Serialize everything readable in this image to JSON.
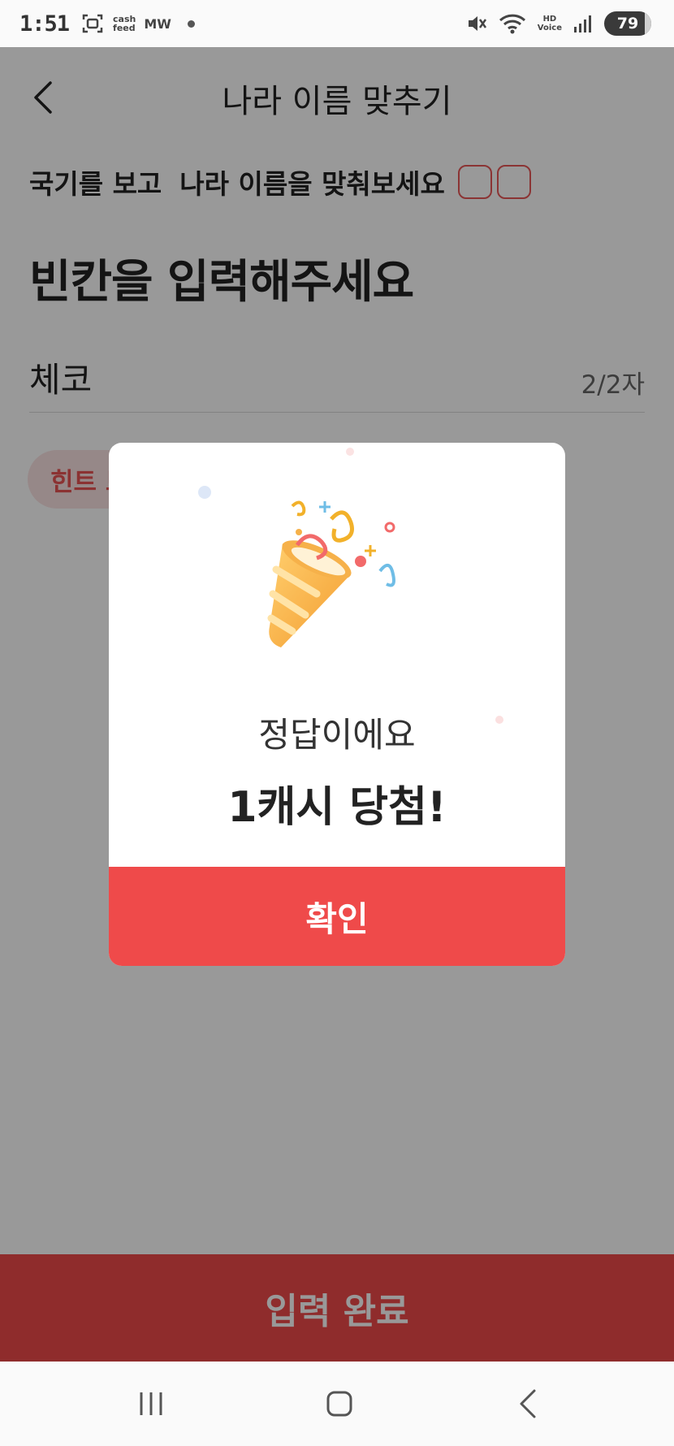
{
  "status_bar": {
    "time": "1:51",
    "app_label_top": "cash",
    "app_label_bottom": "feed",
    "carrier": "MW",
    "hd_top": "HD",
    "hd_bottom": "Voice",
    "battery": "79"
  },
  "header": {
    "title": "나라 이름 맞추기"
  },
  "quiz": {
    "instruction_part1": "국기를 보고",
    "instruction_part2": "나라 이름을 맞춰보세요",
    "blank_count": 2,
    "heading": "빈칸을 입력해주세요",
    "answer_value": "체코",
    "char_count": "2/2자",
    "hint_label": "힌트 보기"
  },
  "bottom_button": {
    "label": "입력 완료"
  },
  "modal": {
    "message": "정답이에요",
    "reward": "1캐시 당첨!",
    "confirm_label": "확인"
  },
  "colors": {
    "accent": "#ef4a4a",
    "hint_bg": "#fbe3e3",
    "overlay": "rgba(0,0,0,0.40)"
  },
  "icons": {
    "back": "chevron-left-icon",
    "party": "party-popper-icon",
    "nav_recents": "recents-icon",
    "nav_home": "home-icon",
    "nav_back": "back-icon"
  }
}
